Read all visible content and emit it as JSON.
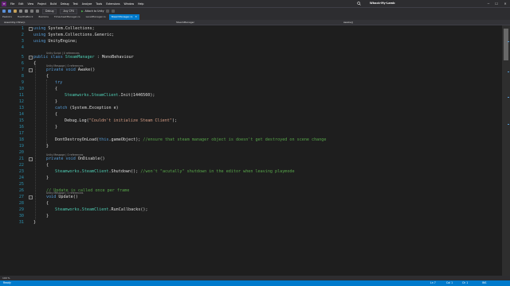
{
  "window": {
    "solution_name": "Whack-My-Lamb",
    "logo_glyph": "∞",
    "menu": [
      "File",
      "Edit",
      "View",
      "Project",
      "Build",
      "Debug",
      "Test",
      "Analyze",
      "Tools",
      "Extensions",
      "Window",
      "Help"
    ],
    "search_icon": "search-icon",
    "controls": {
      "minimize": "─",
      "maximize": "☐",
      "close": "✕"
    }
  },
  "toolbar": {
    "config": "Debug",
    "platform": "Any CPU",
    "attach_label": "Attach to Unity",
    "accent_green": "#4ec24e"
  },
  "tabs": [
    {
      "label": "PeekArs",
      "active": false
    },
    {
      "label": "HealthsBlock",
      "active": false
    },
    {
      "label": "BombCs",
      "active": false
    },
    {
      "label": "TimesheetManager.cs",
      "active": false
    },
    {
      "label": "LevelManager.cs",
      "active": false
    },
    {
      "label": "SteamManager.cs",
      "active": true
    }
  ],
  "navbar": {
    "project": "Assembly-CSharp",
    "class": "SteamManager",
    "member": "Awake()"
  },
  "code": {
    "l1_using": "using",
    "l1_ns": " System.Collections;",
    "l2_using": "using",
    "l2_ns": " System.Collections.Generic;",
    "l3_using": "using",
    "l3_ns": " UnityEngine;",
    "lens_class": "Unity Script | 0 references",
    "l5_kw": "public class ",
    "l5_type": "SteamManager",
    "l5_rest": " : MonoBehaviour",
    "l6": "{",
    "lens_awake": "Unity Message | 0 references",
    "l7_kw": "private void ",
    "l7_rest": "Awake()",
    "l8": "{",
    "l9_kw": "try",
    "l10": "{",
    "l11_type": "Steamworks",
    "l11_dot": ".",
    "l11_type2": "SteamClient",
    "l11_rest": ".Init(1446560);",
    "l12": "}",
    "l13_kw": "catch ",
    "l13_rest": "(System.Exception e)",
    "l14": "{",
    "l15_pre": "Debug.Log(",
    "l15_str": "\"Couldn't initialize Steam Client\"",
    "l15_post": ");",
    "l16": "}",
    "l18_pre": "DontDestroyOnLoad(",
    "l18_this": "this",
    "l18_post": ".gameObject); ",
    "l18_cm": "//ensure that steam manager object is doesn't get destroyed on scene change",
    "l19": "}",
    "lens_disable": "Unity Message | 0 references",
    "l21_kw": "private void ",
    "l21_rest": "OnDisable()",
    "l22": "{",
    "l23_type": "Steamworks",
    "l23_dot": ".",
    "l23_type2": "SteamClient",
    "l23_rest": ".Shutdown(); ",
    "l23_cm": "//won't \"acutally\" shutdown in the editor when leaving playmode",
    "l24": "}",
    "l26_cm": "// Update is called once per frame",
    "lens_update": "Unity Message | 0 references",
    "l27_kw": "void ",
    "l27_rest": "Update()",
    "l28": "{",
    "l29_type": "Steamworks",
    "l29_dot": ".",
    "l29_type2": "SteamClient",
    "l29_rest": ".RunCallbacks();",
    "l30": "}",
    "l31": "}"
  },
  "line_numbers": [
    "1",
    "2",
    "3",
    "4",
    "5",
    "6",
    "7",
    "8",
    "9",
    "10",
    "11",
    "12",
    "13",
    "14",
    "15",
    "16",
    "17",
    "18",
    "19",
    "20",
    "21",
    "22",
    "23",
    "24",
    "25",
    "26",
    "27",
    "28",
    "29",
    "30",
    "31"
  ],
  "zoom": "100 %",
  "status": {
    "left": "Ready",
    "line": "Ln 7",
    "col": "Col 1",
    "ch": "Ch 1",
    "ins": "INS"
  }
}
